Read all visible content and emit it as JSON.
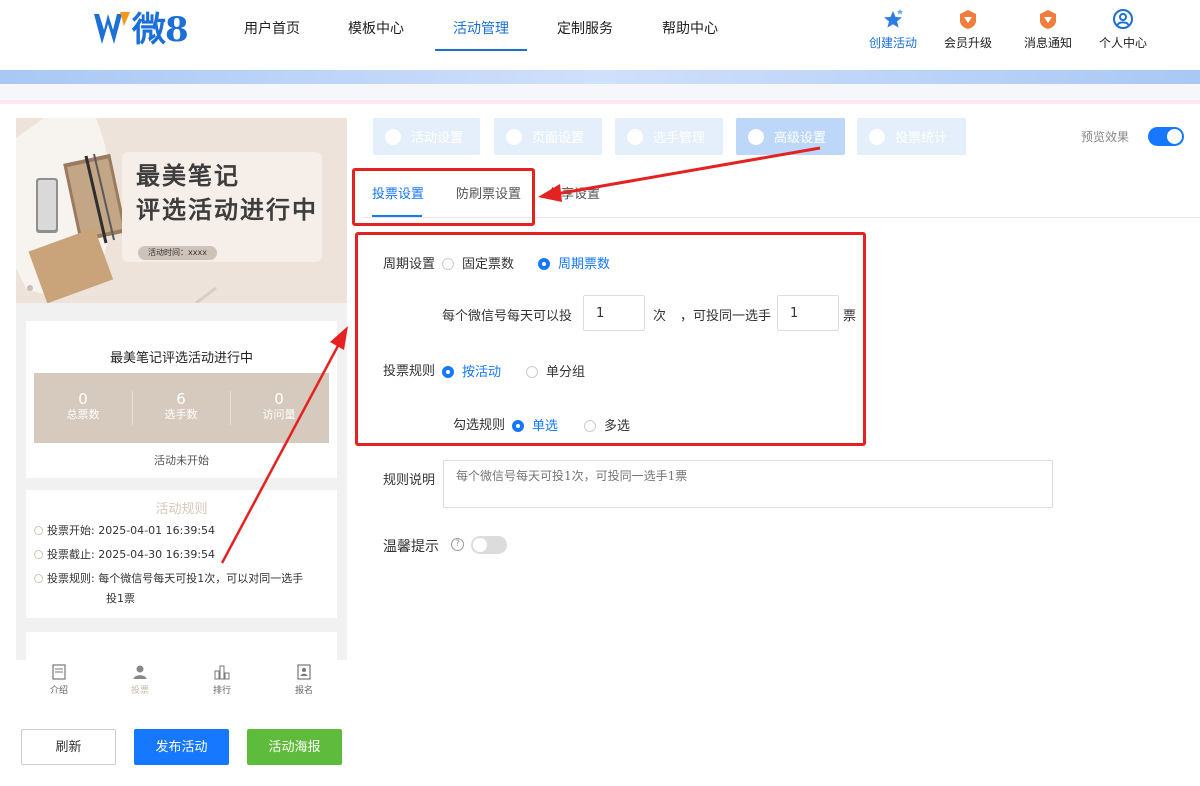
{
  "header": {
    "logo_text": "微8",
    "nav": [
      "用户首页",
      "模板中心",
      "活动管理",
      "定制服务",
      "帮助中心"
    ],
    "active_nav": "活动管理",
    "actions": [
      {
        "label": "创建活动",
        "icon": "star-icon"
      },
      {
        "label": "会员升级",
        "icon": "vip-badge-icon"
      },
      {
        "label": "消息通知",
        "icon": "bell-badge-icon"
      },
      {
        "label": "个人中心",
        "icon": "user-circle-icon"
      }
    ]
  },
  "preview": {
    "banner_line1": "最美笔记",
    "banner_line2": "评选活动进行中",
    "banner_time": "活动时间：xxxx",
    "activity_title": "最美笔记评选活动进行中",
    "stats": [
      {
        "value": "0",
        "label": "总票数"
      },
      {
        "value": "6",
        "label": "选手数"
      },
      {
        "value": "0",
        "label": "访问量"
      }
    ],
    "status": "活动未开始",
    "rules_title": "活动规则",
    "rules": [
      {
        "label": "投票开始:",
        "value": "2025-04-01 16:39:54"
      },
      {
        "label": "投票截止:",
        "value": "2025-04-30 16:39:54"
      },
      {
        "label": "投票规则:",
        "value": "每个微信号每天可投1次，可以对同一选手"
      }
    ],
    "rule_wrap": "投1票",
    "tabbar": [
      {
        "label": "介绍",
        "icon": "document-icon"
      },
      {
        "label": "投票",
        "icon": "person-icon"
      },
      {
        "label": "排行",
        "icon": "bar-chart-icon"
      },
      {
        "label": "报名",
        "icon": "signup-icon"
      }
    ]
  },
  "buttons": {
    "refresh": "刷新",
    "publish": "发布活动",
    "poster": "活动海报"
  },
  "steps": [
    "活动设置",
    "页面设置",
    "选手管理",
    "高级设置",
    "投票统计"
  ],
  "active_step": "高级设置",
  "preview_toggle_label": "预览效果",
  "subtabs": [
    "投票设置",
    "防刷票设置",
    "分享设置"
  ],
  "form": {
    "period_label": "周期设置",
    "period_options": [
      "固定票数",
      "周期票数"
    ],
    "period_selected": "周期票数",
    "per_day_prefix": "每个微信号每天可以投",
    "per_day_value": "1",
    "per_day_unit": "次",
    "same_player_prefix": "，可投同一选手",
    "same_player_value": "1",
    "same_player_unit": "票",
    "rule_label": "投票规则",
    "rule_options": [
      "按活动",
      "单分组"
    ],
    "select_label": "勾选规则",
    "select_options": [
      "单选",
      "多选"
    ],
    "desc_label": "规则说明",
    "desc_placeholder": "每个微信号每天可投1次，可投同一选手1票",
    "tip_label": "温馨提示",
    "help_glyph": "?"
  },
  "colors": {
    "accent": "#1677ff",
    "highlight": "#e52222",
    "poster_green": "#5ebb3c"
  }
}
